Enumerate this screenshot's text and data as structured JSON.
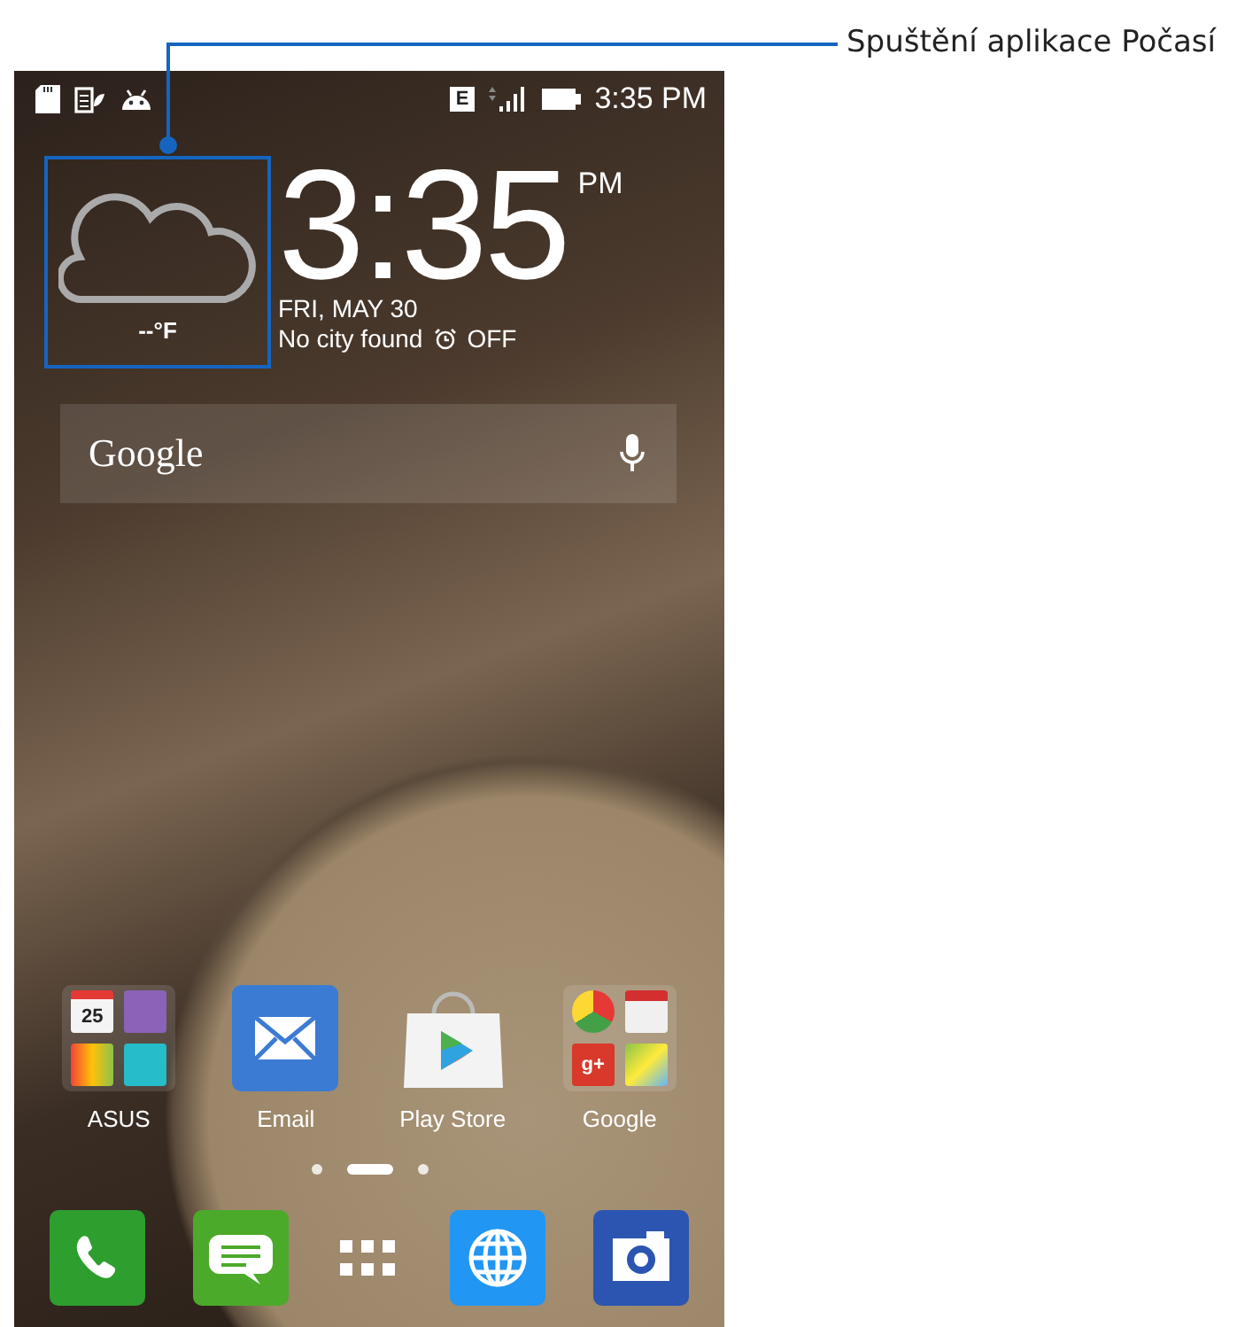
{
  "callout": {
    "label": "Spuštění aplikace Počasí"
  },
  "status_bar": {
    "network": "E",
    "time": "3:35 PM"
  },
  "clock_widget": {
    "temperature": "--°F",
    "time": "3:35",
    "meridiem": "PM",
    "date": "FRI, MAY 30",
    "city": "No city found",
    "alarm": "OFF"
  },
  "search_bar": {
    "logo": "Google"
  },
  "apps": [
    {
      "kind": "folder",
      "label": "ASUS",
      "items": [
        {
          "kind": "calendar",
          "text": "25"
        },
        {
          "kind": "tasks"
        },
        {
          "kind": "balloon"
        },
        {
          "kind": "contacts"
        }
      ]
    },
    {
      "kind": "email",
      "label": "Email"
    },
    {
      "kind": "store",
      "label": "Play Store"
    },
    {
      "kind": "folder",
      "label": "Google",
      "items": [
        {
          "kind": "chrome"
        },
        {
          "kind": "mail"
        },
        {
          "kind": "plus",
          "text": "g+"
        },
        {
          "kind": "maps"
        }
      ]
    }
  ],
  "page_indicator": [
    {
      "selected": false
    },
    {
      "selected": true
    },
    {
      "selected": false
    }
  ],
  "dock": [
    {
      "kind": "phone"
    },
    {
      "kind": "messages"
    },
    {
      "kind": "apps"
    },
    {
      "kind": "browser"
    },
    {
      "kind": "camera"
    }
  ]
}
